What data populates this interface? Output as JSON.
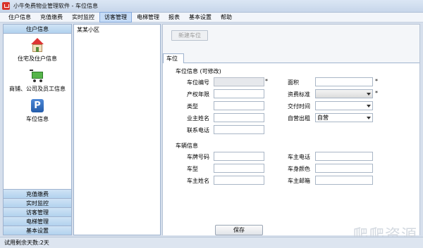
{
  "window": {
    "title": "小牛免费物业管理软件 - 车位信息"
  },
  "menu": [
    "住户信息",
    "充值缴费",
    "实时监控",
    "访客管理",
    "电梯管理",
    "报表",
    "基本设置",
    "帮助"
  ],
  "sidebar": {
    "header": "住户信息",
    "items": [
      {
        "label": "住宅及住户信息",
        "icon": "house-icon"
      },
      {
        "label": "商铺、公司及员工信息",
        "icon": "shopping-cart-icon"
      },
      {
        "label": "车位信息",
        "icon": "parking-icon"
      }
    ],
    "bottom": [
      "充值缴费",
      "实时监控",
      "访客管理",
      "电梯管理",
      "基本设置"
    ]
  },
  "tree": {
    "root": "某某小区"
  },
  "toolbar": {
    "new_parking": "新建车位"
  },
  "tab": {
    "label": "车位"
  },
  "form": {
    "section1": "车位信息 (可修改)",
    "space_no": "车位编号",
    "area": "面积",
    "ownership": "产权年限",
    "fee_std": "资费标准",
    "type": "类型",
    "pay_time": "交付时间",
    "owner_name": "业主姓名",
    "rent_mode": "自营出租",
    "rent_mode_value": "自营",
    "contact": "联系电话",
    "section2": "车辆信息",
    "plate": "车牌号码",
    "car_owner_phone": "车主电话",
    "car_type": "车型",
    "car_color": "车身颜色",
    "car_owner_name": "车主姓名",
    "car_owner_email": "车主邮箱",
    "star": "*",
    "save": "保存"
  },
  "status": {
    "text": "试用剩余天数:2天"
  },
  "watermark": "爬爬资源"
}
